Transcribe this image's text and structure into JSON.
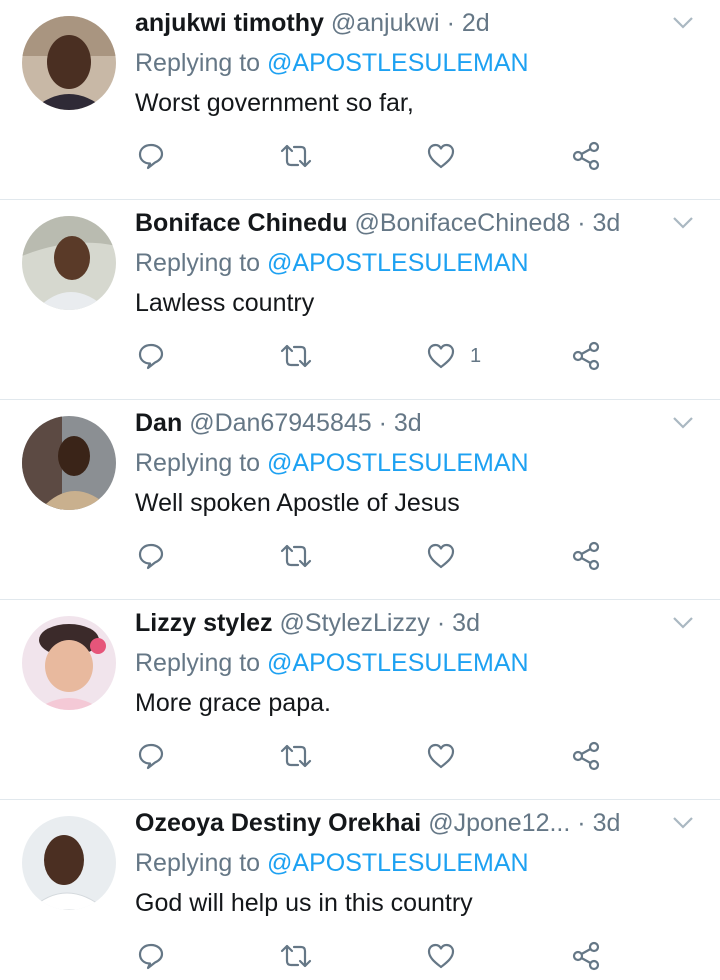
{
  "replying_prefix": "Replying to",
  "tweets": [
    {
      "name": "anjukwi timothy",
      "handle": "@anjukwi",
      "sep": "·",
      "time": "2d",
      "mention": "@APOSTLESULEMAN",
      "text": "Worst government so far,",
      "like_count": ""
    },
    {
      "name": "Boniface Chinedu",
      "handle": "@BonifaceChined8",
      "sep": "·",
      "time": "3d",
      "mention": "@APOSTLESULEMAN",
      "text": "Lawless country",
      "like_count": "1"
    },
    {
      "name": "Dan",
      "handle": "@Dan67945845",
      "sep": "·",
      "time": "3d",
      "mention": "@APOSTLESULEMAN",
      "text": "Well spoken Apostle of Jesus",
      "like_count": ""
    },
    {
      "name": "Lizzy stylez",
      "handle": "@StylezLizzy",
      "sep": "·",
      "time": "3d",
      "mention": "@APOSTLESULEMAN",
      "text": "More grace papa.",
      "like_count": ""
    },
    {
      "name": "Ozeoya Destiny Orekhai",
      "handle": "@Jpone12...",
      "sep": "·",
      "time": "3d",
      "mention": "@APOSTLESULEMAN",
      "text": "God will help us in this country",
      "like_count": ""
    }
  ],
  "icons": {
    "reply": "reply-icon",
    "retweet": "retweet-icon",
    "like": "heart-icon",
    "share": "share-icon",
    "more": "chevron-down-icon"
  },
  "colors": {
    "name": "#14171a",
    "secondary": "#657786",
    "mention": "#1da1f2",
    "divider": "#e1e8ed"
  }
}
